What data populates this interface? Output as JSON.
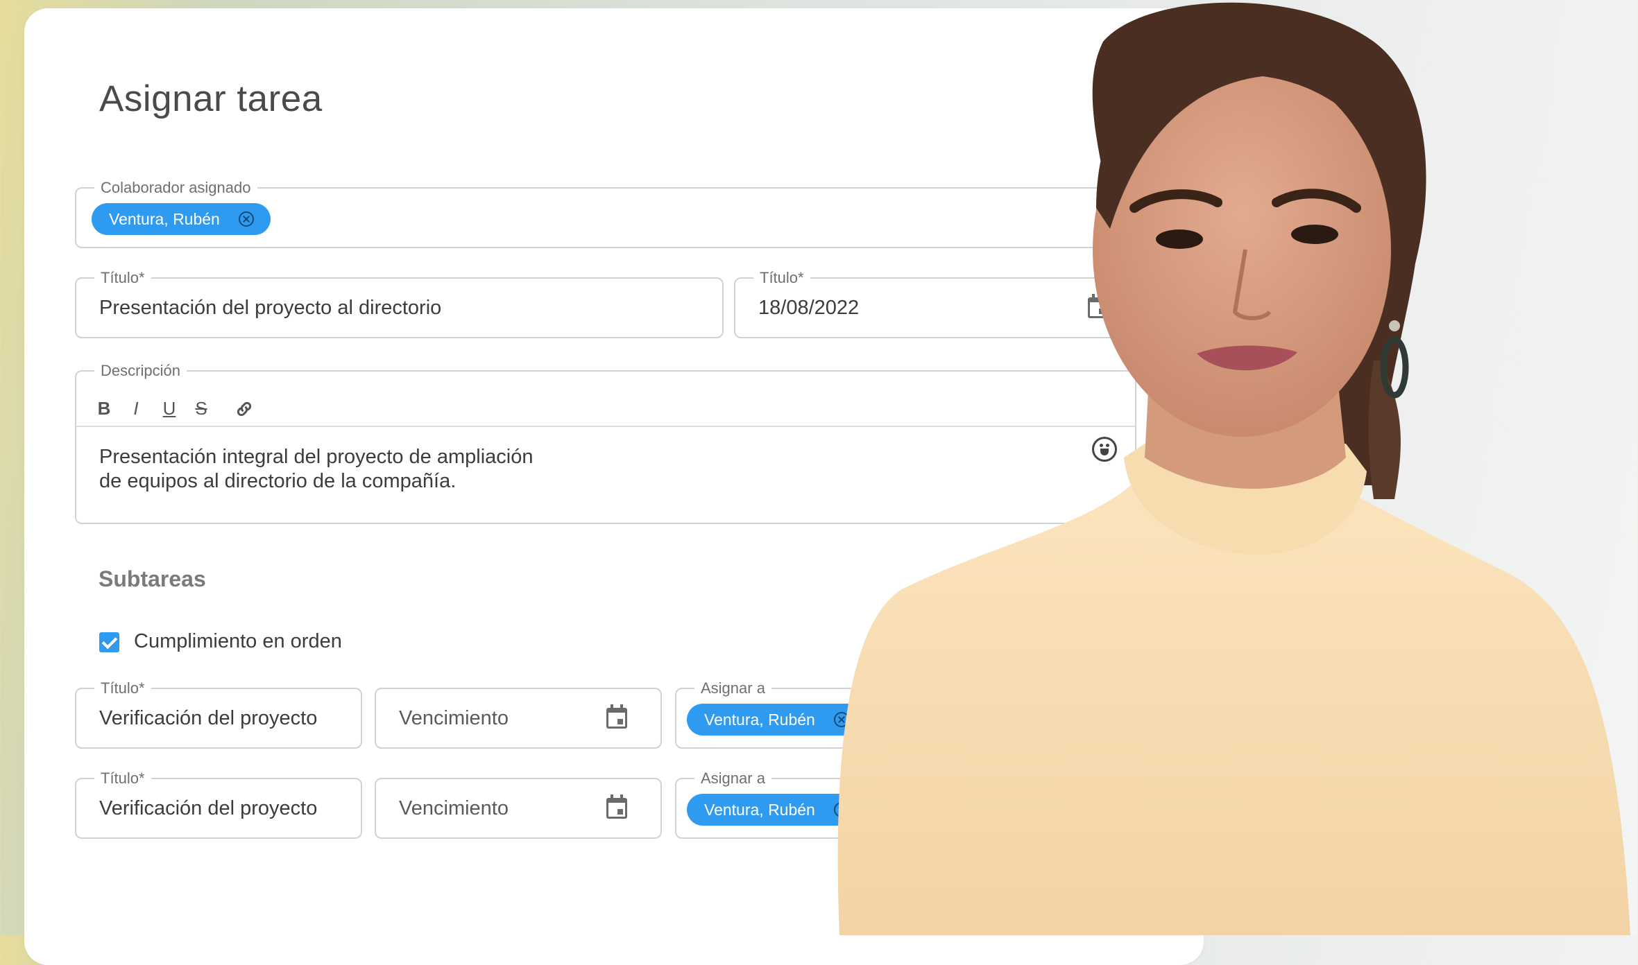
{
  "page": {
    "title": "Asignar tarea"
  },
  "form": {
    "collaborator": {
      "label": "Colaborador asignado",
      "chip": "Ventura, Rubén"
    },
    "title_field": {
      "label": "Título*",
      "value": "Presentación del proyecto al directorio"
    },
    "date_field": {
      "label": "Título*",
      "value": "18/08/2022"
    },
    "description": {
      "label": "Descripción",
      "toolbar": {
        "bold": "B",
        "italic": "I",
        "underline": "U",
        "strike": "S"
      },
      "text_line1": "Presentación integral del proyecto de ampliación",
      "text_line2": "de equipos al directorio de la compañía."
    }
  },
  "subtasks": {
    "heading": "Subtareas",
    "in_order": {
      "label": "Cumplimiento en orden",
      "checked": true
    },
    "rows": [
      {
        "title_label": "Título*",
        "title_value": "Verificación del proyecto",
        "due_placeholder": "Vencimiento",
        "assign_label": "Asignar a",
        "assignee": "Ventura, Rubén"
      },
      {
        "title_label": "Título*",
        "title_value": "Verificación del proyecto",
        "due_placeholder": "Vencimiento",
        "assign_label": "Asignar a",
        "assignee": "Ventura, Rubén"
      }
    ]
  },
  "colors": {
    "accent": "#2f9bf0",
    "card": "#ffffff",
    "text": "#3c3c3c"
  }
}
